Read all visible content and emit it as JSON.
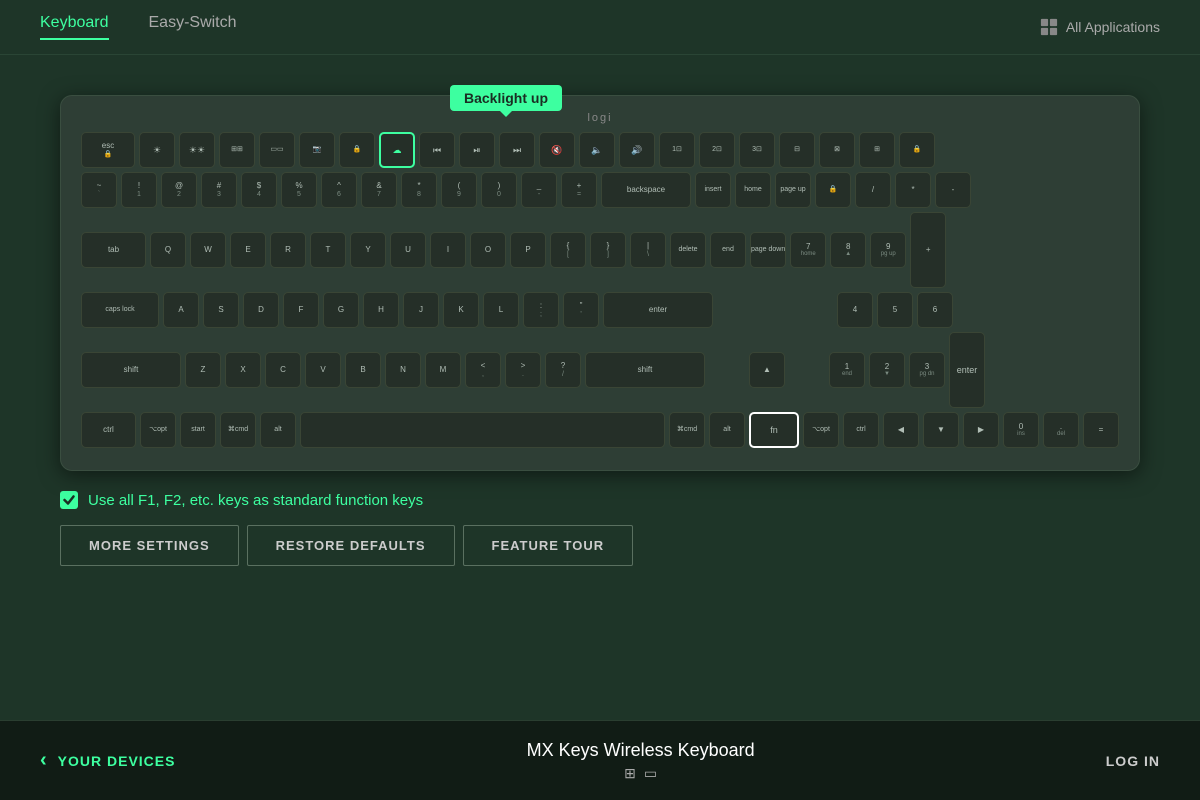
{
  "header": {
    "tab_keyboard": "Keyboard",
    "tab_easy_switch": "Easy-Switch",
    "all_apps_label": "All Applications"
  },
  "tooltip": {
    "text": "Backlight up"
  },
  "keyboard": {
    "logo": "logi"
  },
  "checkbox": {
    "label": "Use all F1, F2, etc. keys as standard function keys"
  },
  "buttons": {
    "more_settings": "MORE SETTINGS",
    "restore_defaults": "RESTORE DEFAULTS",
    "feature_tour": "FEATURE TOUR"
  },
  "footer": {
    "your_devices": "YOUR DEVICES",
    "device_name": "MX Keys Wireless Keyboard",
    "log_in": "LOG IN"
  }
}
